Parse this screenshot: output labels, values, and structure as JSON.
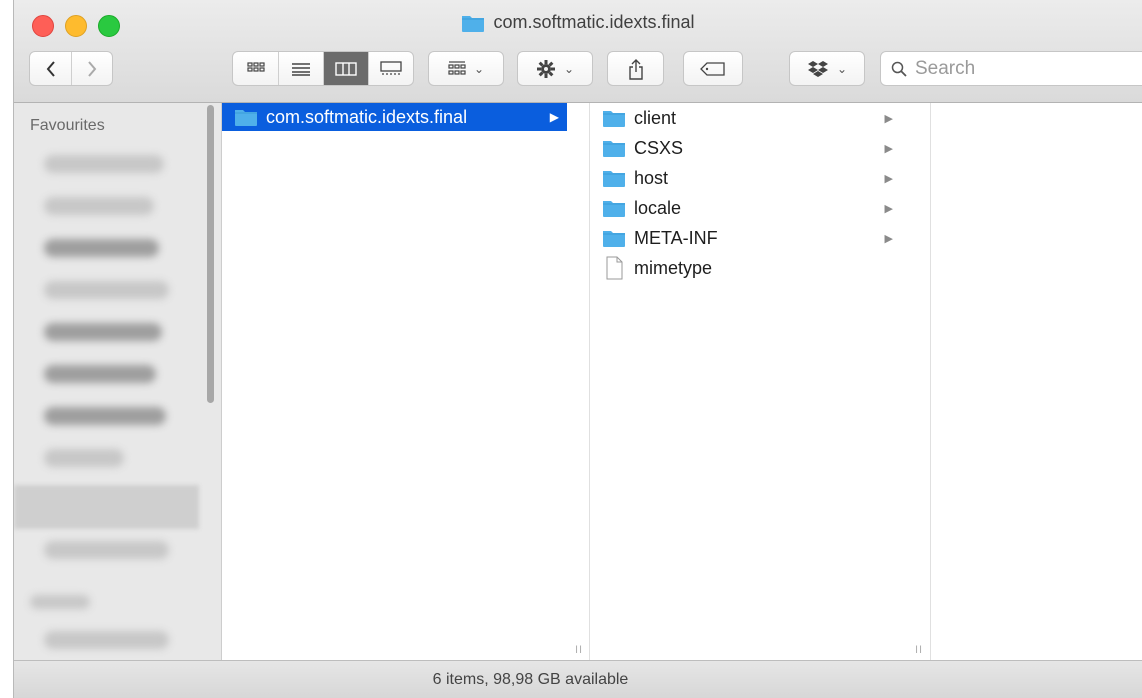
{
  "window": {
    "title": "com.softmatic.idexts.final"
  },
  "toolbar": {
    "search_placeholder": "Search",
    "icons": [
      "back-chevron-icon",
      "forward-chevron-icon",
      "icon-view-icon",
      "list-view-icon",
      "column-view-icon",
      "gallery-view-icon",
      "group-icon",
      "gear-icon",
      "share-icon",
      "tag-icon",
      "dropbox-icon",
      "search-icon"
    ],
    "active_view": "column"
  },
  "sidebar": {
    "heading": "Favourites"
  },
  "columns": {
    "col1": {
      "items": [
        {
          "name": "com.softmatic.idexts.final",
          "kind": "folder",
          "selected": true
        }
      ]
    },
    "col2": {
      "items": [
        {
          "name": "client",
          "kind": "folder"
        },
        {
          "name": "CSXS",
          "kind": "folder"
        },
        {
          "name": "host",
          "kind": "folder"
        },
        {
          "name": "locale",
          "kind": "folder"
        },
        {
          "name": "META-INF",
          "kind": "folder"
        },
        {
          "name": "mimetype",
          "kind": "file"
        }
      ]
    }
  },
  "status": {
    "text": "6 items, 98,98 GB available"
  },
  "colors": {
    "selection": "#0a5ede",
    "folder": "#4fb0ea",
    "close": "#fe5f57",
    "minimize": "#febb2e",
    "maximize": "#2ac940"
  }
}
